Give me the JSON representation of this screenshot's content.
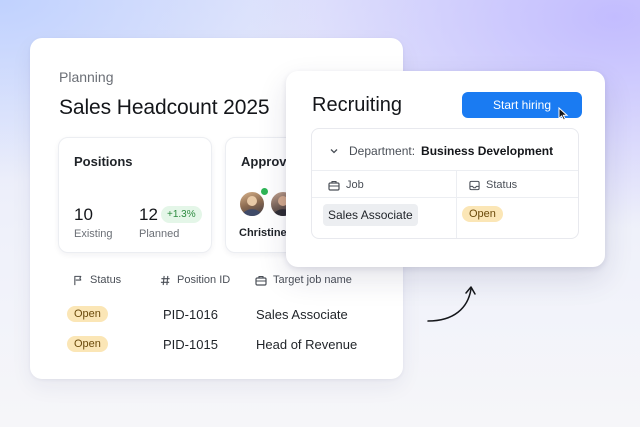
{
  "planning": {
    "label": "Planning",
    "title": "Sales Headcount 2025",
    "positions": {
      "title": "Positions",
      "existing_value": "10",
      "existing_label": "Existing",
      "planned_value": "12",
      "planned_label": "Planned",
      "delta": "+1.3%"
    },
    "approvals": {
      "title": "Approvals",
      "approver_name": "Christine"
    },
    "table": {
      "headers": [
        "Status",
        "Position ID",
        "Target job name"
      ],
      "rows": [
        {
          "status": "Open",
          "position_id": "PID-1016",
          "job": "Sales Associate"
        },
        {
          "status": "Open",
          "position_id": "PID-1015",
          "job": "Head of Revenue"
        }
      ]
    }
  },
  "recruiting": {
    "title": "Recruiting",
    "start_button": "Start hiring",
    "department_key": "Department:",
    "department_value": "Business Development",
    "headers": [
      "Job",
      "Status"
    ],
    "row": {
      "job": "Sales Associate",
      "status": "Open"
    }
  },
  "colors": {
    "primary_button": "#1a7bf2",
    "open_badge": "#fbe6b6",
    "delta_badge": "#e4f6e8",
    "online": "#2eb556"
  },
  "icons": [
    "flag-icon",
    "hash-icon",
    "briefcase-icon",
    "inbox-icon",
    "chevron-down-icon",
    "cursor-icon",
    "curved-arrow-icon"
  ]
}
